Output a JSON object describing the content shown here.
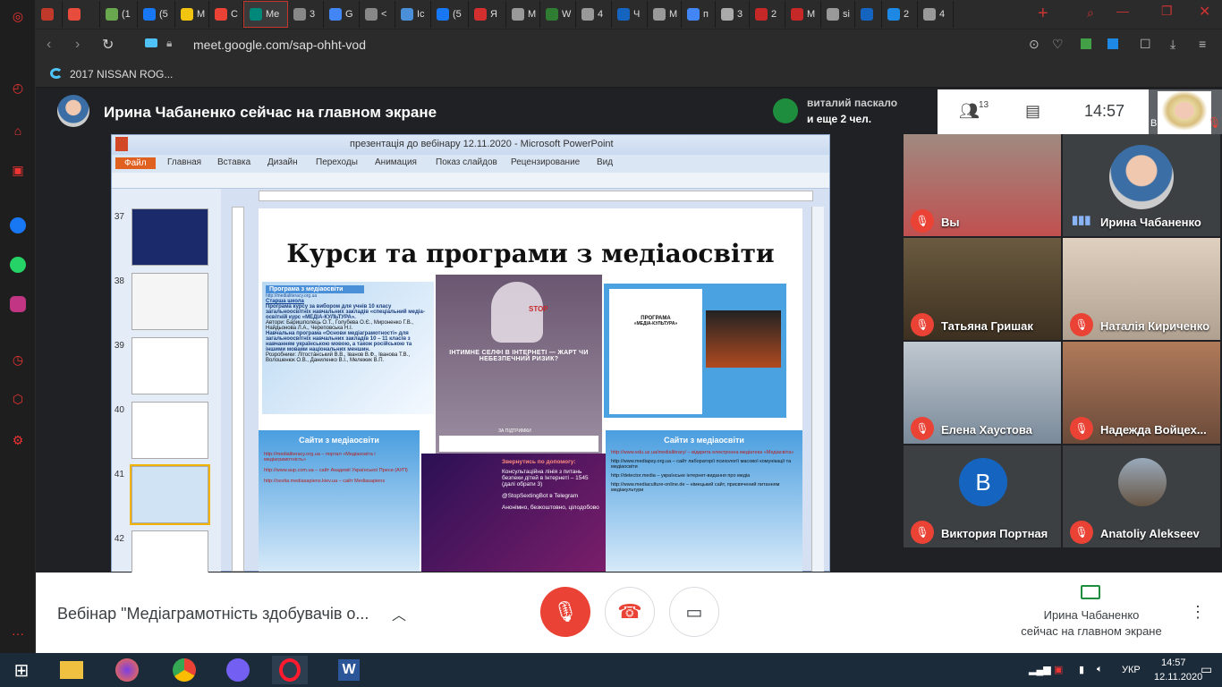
{
  "browser": {
    "tabs": [
      {
        "label": "",
        "color": "#c0392b"
      },
      {
        "label": "",
        "color": "#e74c3c"
      },
      {
        "label": "(1",
        "color": "#6aa84f"
      },
      {
        "label": "(5",
        "color": "#1877f2"
      },
      {
        "label": "M",
        "color": "#f1c40f"
      },
      {
        "label": "C",
        "color": "#ea4335"
      },
      {
        "label": "Me",
        "color": "#00897b",
        "active": true
      },
      {
        "label": "3",
        "color": "#888"
      },
      {
        "label": "G",
        "color": "#4285f4"
      },
      {
        "label": "<",
        "color": "#888"
      },
      {
        "label": "Ic",
        "color": "#4a90d9"
      },
      {
        "label": "(5",
        "color": "#1877f2"
      },
      {
        "label": "Я",
        "color": "#d32f2f"
      },
      {
        "label": "M",
        "color": "#999"
      },
      {
        "label": "W",
        "color": "#2e7d32"
      },
      {
        "label": "4",
        "color": "#999"
      },
      {
        "label": "Ч",
        "color": "#1565c0"
      },
      {
        "label": "M",
        "color": "#999"
      },
      {
        "label": "п",
        "color": "#4285f4"
      },
      {
        "label": "3",
        "color": "#aaa"
      },
      {
        "label": "2",
        "color": "#c62828"
      },
      {
        "label": "M",
        "color": "#c62828"
      },
      {
        "label": "si",
        "color": "#999"
      },
      {
        "label": "",
        "color": "#1565c0"
      },
      {
        "label": "2",
        "color": "#1e88e5"
      },
      {
        "label": "4",
        "color": "#999"
      }
    ],
    "url": "meet.google.com/sap-ohht-vod",
    "bookmark": "2017 NISSAN ROG..."
  },
  "meet": {
    "presenter_banner": "Ирина Чабаненко сейчас на главном экране",
    "chat_notice_name": "виталий паскало",
    "chat_notice_more": "и еще 2 чел.",
    "participants_count": "13",
    "time": "14:57",
    "self_label": "Вы",
    "meeting_title": "Вебінар \"Медіаграмотність здобувачів о...",
    "presenting_line1": "Ирина Чабаненко",
    "presenting_line2": "сейчас на главном экране",
    "participants": [
      {
        "name": "Вы",
        "muted": true
      },
      {
        "name": "Ирина Чабаненко",
        "muted": false
      },
      {
        "name": "Татьяна Гришак",
        "muted": true
      },
      {
        "name": "Наталія Кириченко",
        "muted": true
      },
      {
        "name": "Елена Хаустова",
        "muted": true
      },
      {
        "name": "Надежда Войцех...",
        "muted": true
      },
      {
        "name": "Виктория Портная",
        "muted": true,
        "initial": "В"
      },
      {
        "name": "Anatoliy Alekseev",
        "muted": true
      }
    ]
  },
  "powerpoint": {
    "title": "презентація до вебінару 12.11.2020  -  Microsoft PowerPoint",
    "menu": [
      "Файл",
      "Главная",
      "Вставка",
      "Дизайн",
      "Переходы",
      "Анимация",
      "Показ слайдов",
      "Рецензирование",
      "Вид"
    ],
    "slide_numbers": [
      "37",
      "38",
      "39",
      "40",
      "41",
      "42"
    ],
    "slide_title": "Курси та програми з медіаосвіти",
    "box1_title": "Програма з медіаосвіти",
    "box1_url": "http://medialiteracy.org.ua",
    "box1_school": "Старша школа",
    "box1_text": "Програма курсу за вибором для учнів 10 класу загальноосвітніх навчальних закладів «спеціальний медіа-освітній курс «МЕДІА-КУЛЬТУРА».",
    "box1_authors": "Автори: Баришполець О.Т., Голубева О.Є., Мироненко Г.В., Найдьонова Л.А., Череповська Н.І.",
    "box1_text2": "Навчальна програма «Основи медіаграмотності» для загальноосвітніх навчальних закладів 10 – 11 класів з навчанням українською мовою, а також російською та іншими мовами національних меншин.",
    "box1_devs": "Розробники: Літоста́нський В.В., Іванов В.Ф., Іванова Т.В., Волошенюк О.В., Даниленко В.І., Мележик В.П.",
    "center_title": "ІНТИМНЕ СЕЛФІ В ІНТЕРНЕТІ — ЖАРТ ЧИ НЕБЕЗПЕЧНИЙ РИЗИК?",
    "center_stop": "STOP",
    "center_support": "ЗА ПІДТРИМКИ",
    "right_program": "ПРОГРАМА",
    "right_course": "«МЕДІА-КУЛЬТУРА»",
    "site1_title": "Сайти з медіаосвіти",
    "site1_l1": "http://medialiteracy.org.ua – портал «Медіаосвіта і медіаграмотність»",
    "site1_l2": "http://www.aup.com.ua – сайт Академії Української Преси (АУП)",
    "site1_l3": "http://osvita.mediasapiens.kiev.ua – сайт Mediasapiens",
    "help_title": "Звернутись по допомогу:",
    "help_1": "Консультаційна лінія з питань безпеки дітей в Інтернеті – 1545 (далі обрати 3)",
    "help_2": "@StopSextingBot в Telegram",
    "help_3": "Анонімно, безкоштовно, цілодобово",
    "site2_title": "Сайти з медіаосвіти",
    "site2_l1": "http://www.edu.uz.ua/medialibrary/ – відкрита електронна медіатека «Медіасвіта»",
    "site2_l2": "http://www.mediapsy.org.ua – сайт лабораторії психології масової комунікації та медіаосвіти",
    "site2_l3": "http://detector.media – українське інтернет-видання про медіа",
    "site2_l4": "http://www.mediaculture-online.de – німецький сайт, присвячений питанням медіакультури"
  },
  "taskbar": {
    "lang": "УКР",
    "time": "14:57",
    "date": "12.11.2020"
  }
}
